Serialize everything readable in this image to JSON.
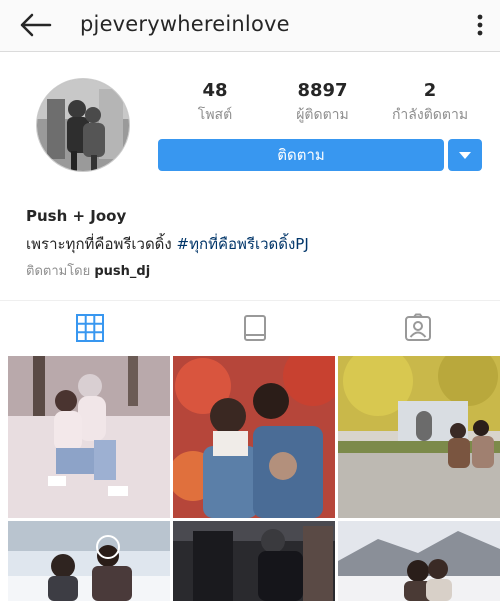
{
  "header": {
    "username": "pjeverywhereinlove",
    "back_icon": "arrow-left-icon",
    "menu_icon": "kebab-menu-icon"
  },
  "profile": {
    "stats": {
      "posts_count": "48",
      "posts_label": "โพสต์",
      "followers_count": "8897",
      "followers_label": "ผู้ติดตาม",
      "following_count": "2",
      "following_label": "กำลังติดตาม"
    },
    "follow_label": "ติดตาม",
    "name": "Push + Jooy",
    "bio_text": "เพราะทุกที่คือพรีเวดดิ้ง ",
    "bio_hashtag": "#ทุกที่คือพรีเวดดิ้งPJ",
    "followed_by_label": "ติดตามโดย ",
    "followed_by_user": "push_dj"
  },
  "tabs": [
    {
      "icon": "grid-icon",
      "active": true
    },
    {
      "icon": "feed-icon",
      "active": false
    },
    {
      "icon": "tagged-icon",
      "active": false
    }
  ],
  "colors": {
    "accent": "#3897f0",
    "hashtag": "#003569",
    "muted": "#8e8e8e",
    "text": "#262626"
  }
}
